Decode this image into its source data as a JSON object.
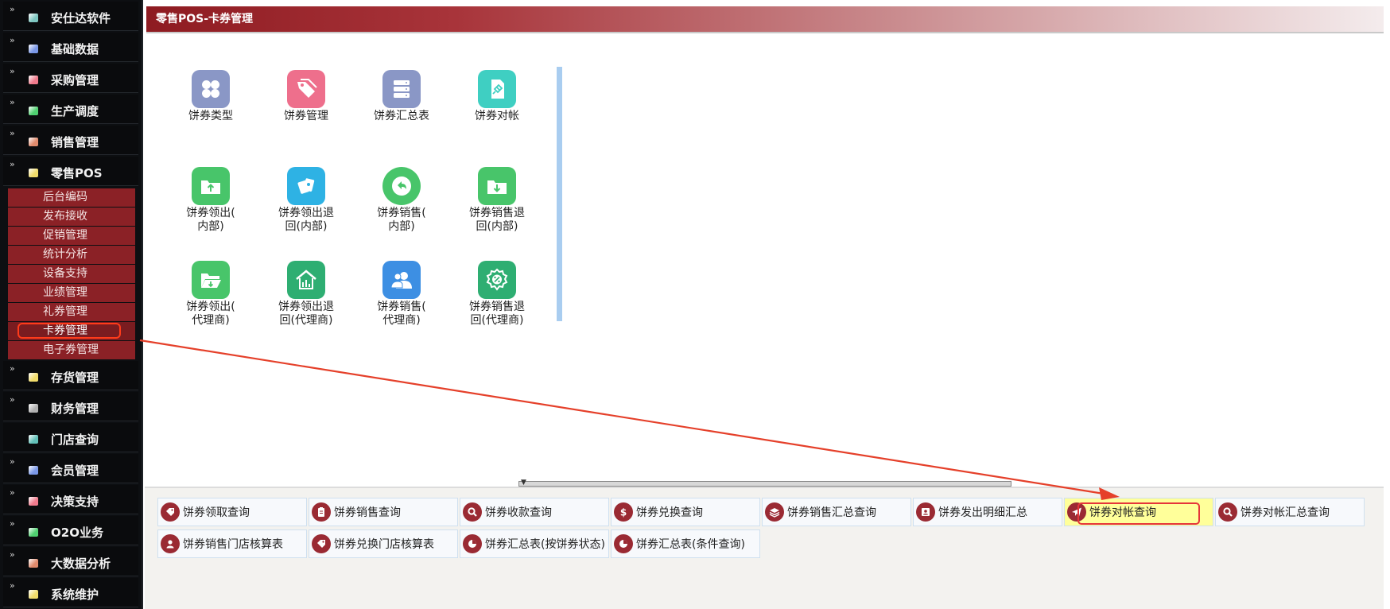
{
  "sidebar": {
    "items": [
      {
        "label": "安仕达软件",
        "color": "#7dc6c0"
      },
      {
        "label": "基础数据",
        "color": "#7a97e6"
      },
      {
        "label": "采购管理",
        "color": "#f07a8c"
      },
      {
        "label": "生产调度",
        "color": "#4fd070"
      },
      {
        "label": "销售管理",
        "color": "#e08a6c"
      },
      {
        "label": "零售POS",
        "color": "#f1dc6a"
      },
      {
        "label": "存货管理",
        "color": "#f1dc6a"
      },
      {
        "label": "财务管理",
        "color": "#b0b0b0"
      },
      {
        "label": "门店查询",
        "color": "#62c0b8"
      },
      {
        "label": "会员管理",
        "color": "#7a97e6"
      },
      {
        "label": "决策支持",
        "color": "#f07a8c"
      },
      {
        "label": "O2O业务",
        "color": "#4fd070"
      },
      {
        "label": "大数据分析",
        "color": "#e08a6c"
      },
      {
        "label": "系统维护",
        "color": "#f1dc6a"
      }
    ],
    "submenu": [
      "后台编码",
      "发布接收",
      "促销管理",
      "统计分析",
      "设备支持",
      "业绩管理",
      "礼券管理",
      "卡券管理",
      "电子券管理"
    ]
  },
  "main": {
    "title": "零售POS-卡券管理",
    "tiles": [
      {
        "line1": "饼券类型",
        "line2": "",
        "icon": "grid-icon",
        "color": "#8a97c6"
      },
      {
        "line1": "饼券管理",
        "line2": "",
        "icon": "tag-icon",
        "color": "#ee6f8c"
      },
      {
        "line1": "饼券汇总表",
        "line2": "",
        "icon": "database-icon",
        "color": "#8a97c6"
      },
      {
        "line1": "饼券对帐",
        "line2": "",
        "icon": "pin-icon",
        "color": "#3fcfc2"
      },
      {
        "line1": "饼券领出(",
        "line2": "内部)",
        "icon": "folder-up-icon",
        "color": "#48c56a"
      },
      {
        "line1": "饼券领出退",
        "line2": "回(内部)",
        "icon": "cards-icon",
        "color": "#2eb2e4"
      },
      {
        "line1": "饼券销售(",
        "line2": "内部)",
        "icon": "undo-icon",
        "color": "#48c56a"
      },
      {
        "line1": "饼券销售退",
        "line2": "回(内部)",
        "icon": "folder-down-icon",
        "color": "#48c56a"
      },
      {
        "line1": "饼券领出(",
        "line2": "代理商)",
        "icon": "folder-open-icon",
        "color": "#48c56a"
      },
      {
        "line1": "饼券领出退",
        "line2": "回(代理商)",
        "icon": "building-icon",
        "color": "#2eae72"
      },
      {
        "line1": "饼券销售(",
        "line2": "代理商)",
        "icon": "users-icon",
        "color": "#3d8fe3"
      },
      {
        "line1": "饼券销售退",
        "line2": "回(代理商)",
        "icon": "percent-badge-icon",
        "color": "#2eae72"
      }
    ]
  },
  "quick": [
    {
      "label": "饼券领取查询",
      "icon": "tag-icon"
    },
    {
      "label": "饼券销售查询",
      "icon": "clipboard-icon"
    },
    {
      "label": "饼券收款查询",
      "icon": "search-icon"
    },
    {
      "label": "饼券兑换查询",
      "icon": "dollar-icon"
    },
    {
      "label": "饼券销售汇总查询",
      "icon": "layers-icon"
    },
    {
      "label": "饼券发出明细汇总",
      "icon": "contact-card-icon"
    },
    {
      "label": "饼券对帐查询",
      "icon": "send-icon"
    },
    {
      "label": "饼券对帐汇总查询",
      "icon": "search-icon"
    },
    {
      "label": "饼券销售门店核算表",
      "icon": "user-icon"
    },
    {
      "label": "饼券兑换门店核算表",
      "icon": "tag-icon"
    },
    {
      "label": "饼券汇总表(按饼券状态)",
      "icon": "pie-icon"
    },
    {
      "label": "饼券汇总表(条件查询)",
      "icon": "pie-icon"
    }
  ]
}
